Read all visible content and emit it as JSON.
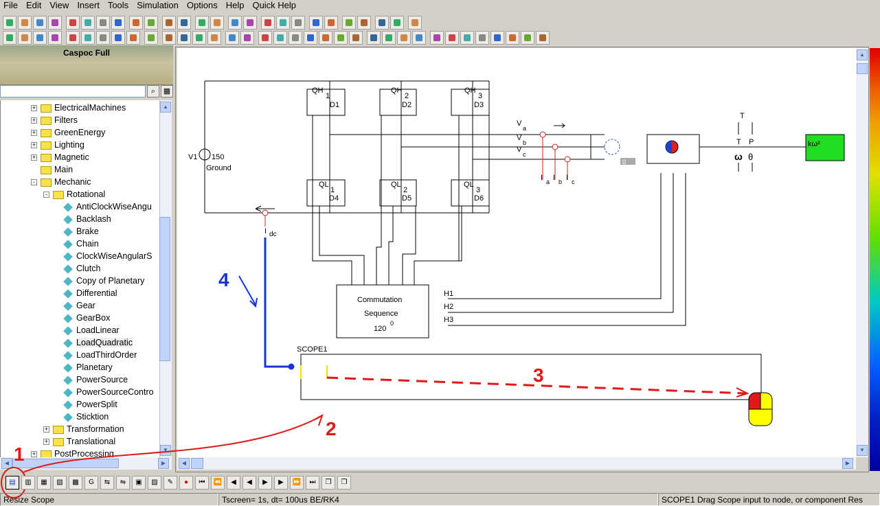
{
  "menu": [
    "File",
    "Edit",
    "View",
    "Insert",
    "Tools",
    "Simulation",
    "Options",
    "Help",
    "Quick Help"
  ],
  "library": {
    "title": "Caspoc Full",
    "search_placeholder": ""
  },
  "tree": [
    {
      "label": "ElectricalMachines",
      "level": 0,
      "type": "folder",
      "expand": "+"
    },
    {
      "label": "Filters",
      "level": 0,
      "type": "folder",
      "expand": "+"
    },
    {
      "label": "GreenEnergy",
      "level": 0,
      "type": "folder",
      "expand": "+"
    },
    {
      "label": "Lighting",
      "level": 0,
      "type": "folder",
      "expand": "+"
    },
    {
      "label": "Magnetic",
      "level": 0,
      "type": "folder",
      "expand": "+"
    },
    {
      "label": "Main",
      "level": 0,
      "type": "folder",
      "expand": ""
    },
    {
      "label": "Mechanic",
      "level": 0,
      "type": "folder",
      "expand": "-"
    },
    {
      "label": "Rotational",
      "level": 1,
      "type": "folder",
      "expand": "-"
    },
    {
      "label": "AntiClockWiseAngu",
      "level": 2,
      "type": "comp"
    },
    {
      "label": "Backlash",
      "level": 2,
      "type": "comp"
    },
    {
      "label": "Brake",
      "level": 2,
      "type": "comp"
    },
    {
      "label": "Chain",
      "level": 2,
      "type": "comp"
    },
    {
      "label": "ClockWiseAngularS",
      "level": 2,
      "type": "comp"
    },
    {
      "label": "Clutch",
      "level": 2,
      "type": "comp"
    },
    {
      "label": "Copy of Planetary",
      "level": 2,
      "type": "comp"
    },
    {
      "label": "Differential",
      "level": 2,
      "type": "comp"
    },
    {
      "label": "Gear",
      "level": 2,
      "type": "comp"
    },
    {
      "label": "GearBox",
      "level": 2,
      "type": "comp"
    },
    {
      "label": "LoadLinear",
      "level": 2,
      "type": "comp"
    },
    {
      "label": "LoadQuadratic",
      "level": 2,
      "type": "comp",
      "selected": true
    },
    {
      "label": "LoadThirdOrder",
      "level": 2,
      "type": "comp"
    },
    {
      "label": "Planetary",
      "level": 2,
      "type": "comp"
    },
    {
      "label": "PowerSource",
      "level": 2,
      "type": "comp"
    },
    {
      "label": "PowerSourceContro",
      "level": 2,
      "type": "comp"
    },
    {
      "label": "PowerSplit",
      "level": 2,
      "type": "comp"
    },
    {
      "label": "Sticktion",
      "level": 2,
      "type": "comp"
    },
    {
      "label": "Transformation",
      "level": 1,
      "type": "folder",
      "expand": "+"
    },
    {
      "label": "Translational",
      "level": 1,
      "type": "folder",
      "expand": "+"
    },
    {
      "label": "PostProcessing",
      "level": 0,
      "type": "folder",
      "expand": "+"
    }
  ],
  "schematic": {
    "labels": {
      "qh1": "QH",
      "qh1n": "1",
      "d1": "D1",
      "qh2": "QH",
      "qh2n": "2",
      "d2": "D2",
      "qh3": "QH",
      "qh3n": "3",
      "d3": "D3",
      "ql1": "QL",
      "ql1n": "1",
      "d4": "D4",
      "ql2": "QL",
      "ql2n": "2",
      "d5": "D5",
      "ql3": "QL",
      "ql3n": "3",
      "d6": "D6",
      "v1": "V1",
      "v150": "150",
      "ground": "Ground",
      "va": "V",
      "va_sub": "a",
      "vb": "V",
      "vb_sub": "b",
      "vc": "V",
      "vc_sub": "c",
      "ia": "I",
      "ia_sub": "a",
      "ib": "I",
      "ib_sub": "b",
      "ic": "I",
      "ic_sub": "c",
      "idc": "I",
      "idc_sub": "dc",
      "zero": "0",
      "T1": "T",
      "T2": "T",
      "P": "P",
      "omega": "ω",
      "theta": "θ",
      "kw2": "kω²",
      "h1": "H1",
      "h2": "H2",
      "h3": "H3",
      "scope": "SCOPE1"
    },
    "commutation": {
      "line1": "Commutation",
      "line2": "Sequence",
      "line3": "120",
      "deg": "0"
    }
  },
  "annotations": {
    "a1": "1",
    "a2": "2",
    "a3": "3",
    "a4": "4"
  },
  "status": {
    "left": "Resize Scope",
    "mid": "Tscreen= 1s, dt= 100us BE/RK4",
    "right": "SCOPE1  Drag Scope input to node, or component  Res"
  },
  "colors": {
    "annotation_red": "#e01818",
    "annotation_blue": "#1434d8",
    "wire": "#000000",
    "probe": "#d02020"
  }
}
